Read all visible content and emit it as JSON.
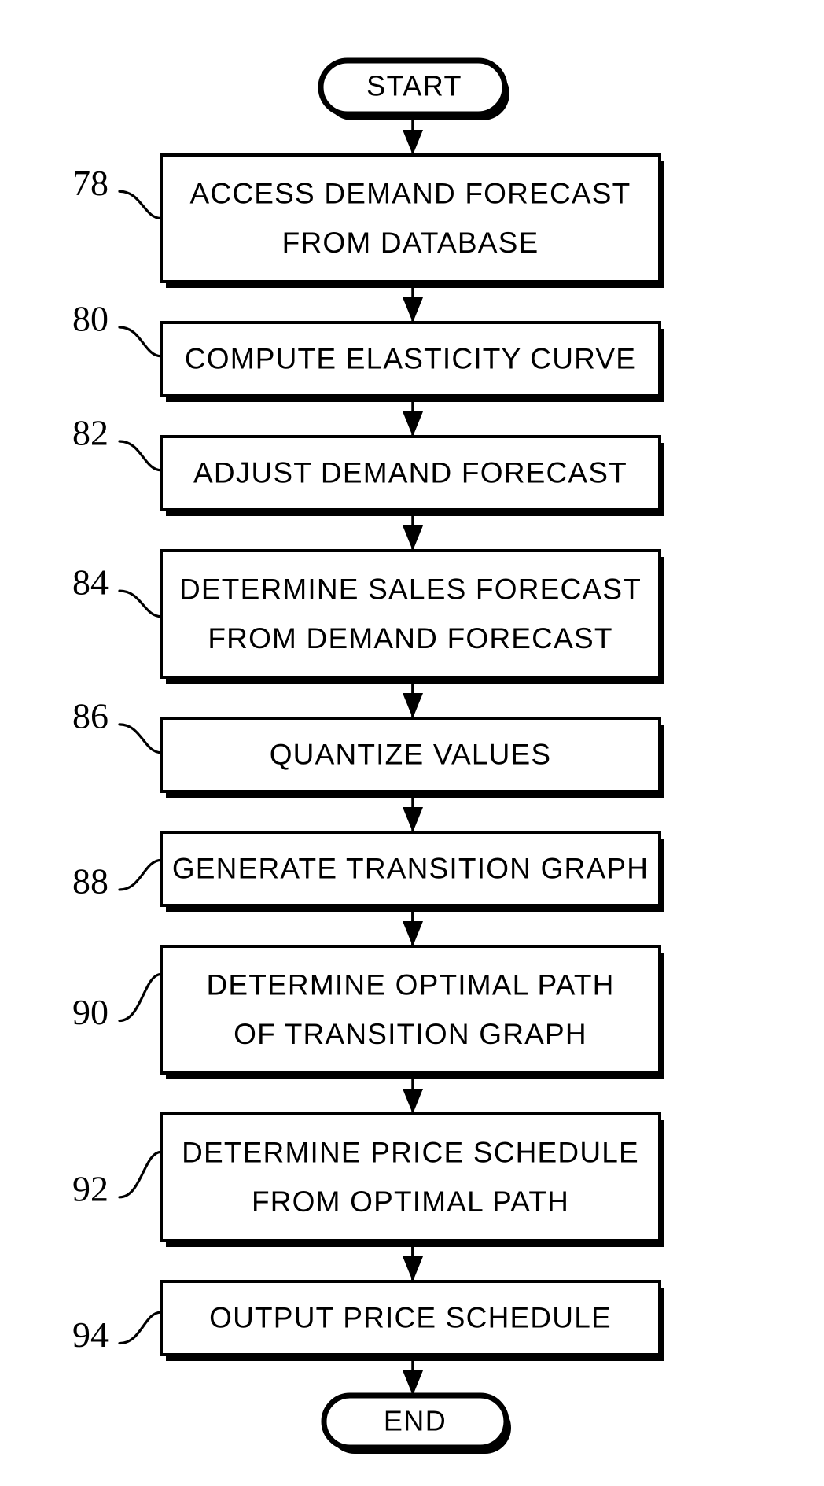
{
  "figure": {
    "type": "flowchart",
    "orientation": "vertical",
    "terminals": {
      "start": {
        "label": "START"
      },
      "end": {
        "label": "END"
      }
    },
    "steps": [
      {
        "ref": "78",
        "lines": [
          "ACCESS  DEMAND  FORECAST",
          "FROM  DATABASE"
        ],
        "line1": "ACCESS  DEMAND  FORECAST",
        "line2": "FROM  DATABASE"
      },
      {
        "ref": "80",
        "lines": [
          "COMPUTE  ELASTICITY  CURVE"
        ],
        "line1": "COMPUTE  ELASTICITY  CURVE",
        "line2": ""
      },
      {
        "ref": "82",
        "lines": [
          "ADJUST  DEMAND  FORECAST"
        ],
        "line1": "ADJUST  DEMAND  FORECAST",
        "line2": ""
      },
      {
        "ref": "84",
        "lines": [
          "DETERMINE  SALES  FORECAST",
          "FROM  DEMAND  FORECAST"
        ],
        "line1": "DETERMINE  SALES  FORECAST",
        "line2": "FROM  DEMAND  FORECAST"
      },
      {
        "ref": "86",
        "lines": [
          "QUANTIZE  VALUES"
        ],
        "line1": "QUANTIZE  VALUES",
        "line2": ""
      },
      {
        "ref": "88",
        "lines": [
          "GENERATE  TRANSITION  GRAPH"
        ],
        "line1": "GENERATE  TRANSITION  GRAPH",
        "line2": ""
      },
      {
        "ref": "90",
        "lines": [
          "DETERMINE  OPTIMAL  PATH",
          "OF  TRANSITION  GRAPH"
        ],
        "line1": "DETERMINE  OPTIMAL  PATH",
        "line2": "OF  TRANSITION  GRAPH"
      },
      {
        "ref": "92",
        "lines": [
          "DETERMINE  PRICE  SCHEDULE",
          "FROM  OPTIMAL  PATH"
        ],
        "line1": "DETERMINE  PRICE  SCHEDULE",
        "line2": "FROM  OPTIMAL  PATH"
      },
      {
        "ref": "94",
        "lines": [
          "OUTPUT  PRICE  SCHEDULE"
        ],
        "line1": "OUTPUT  PRICE  SCHEDULE",
        "line2": ""
      }
    ],
    "colors": {
      "stroke": "#000000",
      "fill": "#ffffff",
      "background": "#ffffff"
    }
  }
}
